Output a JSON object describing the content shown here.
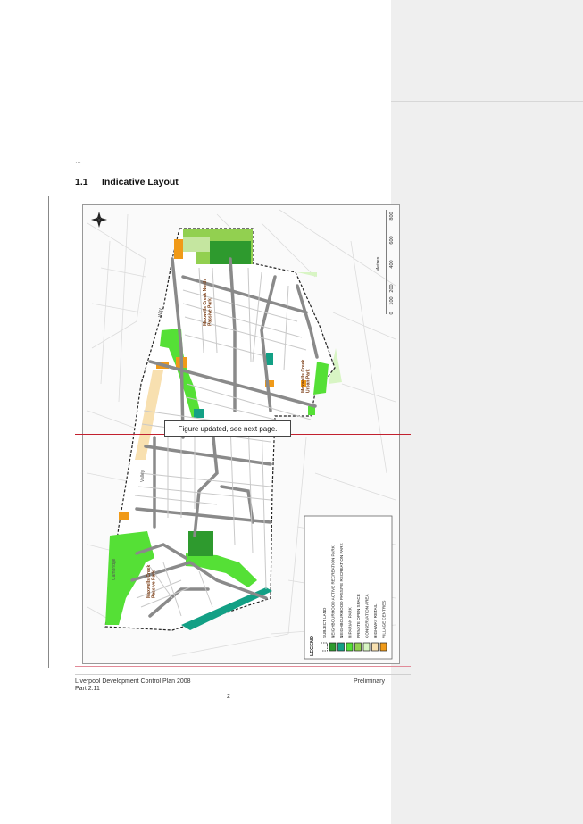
{
  "heading": {
    "number": "1.1",
    "title": "Indicative Layout"
  },
  "note": "Figure updated, see next page.",
  "map": {
    "labels": {
      "park_north": "Maxwells Creek North\nPassive Park",
      "park_east": "Maxwells Creek\nUrban Park",
      "park_south": "Maxwells Creek\nPassive Park",
      "road_way": "Way",
      "road_valley": "Valley",
      "road_cambridge": "Cambridge"
    },
    "scale": {
      "unit": "Metres",
      "ticks": [
        "0",
        "100",
        "200",
        "400",
        "600",
        "800"
      ]
    },
    "legend": {
      "title": "LEGEND",
      "items": [
        {
          "label": "SUBJECT LAND",
          "color": "#ffffff",
          "style": "dashed"
        },
        {
          "label": "NEIGHBOURHOOD ACTIVE RECREATION PARK",
          "color": "#2e9a2e",
          "style": "fill"
        },
        {
          "label": "NEIGHBOURHOOD PASSIVE RECREATION PARK",
          "color": "#13a085",
          "style": "fill"
        },
        {
          "label": "RIPARIAN PARK",
          "color": "#55e036",
          "style": "fill"
        },
        {
          "label": "PRIVATE OPEN SPACE",
          "color": "#92d050",
          "style": "fill"
        },
        {
          "label": "CONSERVATION AREA",
          "color": "#d8f5c4",
          "style": "fill"
        },
        {
          "label": "HIGHWAY RETAIL",
          "color": "#f8e0b0",
          "style": "fill"
        },
        {
          "label": "VILLAGE CENTRES",
          "color": "#f09a18",
          "style": "fill"
        }
      ]
    }
  },
  "footer": {
    "title": "Liverpool Development Control Plan 2008",
    "part": "Part 2.11",
    "status": "Preliminary",
    "page": "2"
  }
}
